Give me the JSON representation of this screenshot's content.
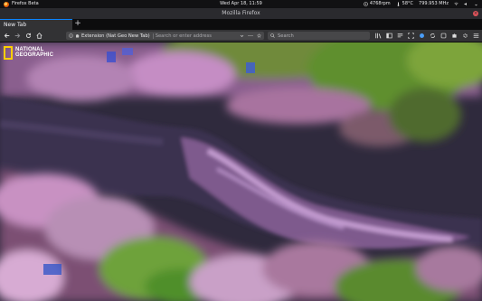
{
  "system_bar": {
    "app_name": "Firefox Beta",
    "clock": "Wed Apr 18, 11:59",
    "cpu_fan": "4768rpm",
    "temperature": "58°C",
    "cpu_freq": "799.953 MHz"
  },
  "window": {
    "title": "Mozilla Firefox"
  },
  "tabs": [
    {
      "label": "New Tab",
      "active": true
    }
  ],
  "new_tab_symbol": "+",
  "url_bar": {
    "identity_label": "Extension (Nat Geo New Tab)",
    "placeholder": "Search or enter address",
    "value": ""
  },
  "search_bar": {
    "placeholder": "Search",
    "value": ""
  },
  "logo": {
    "line1": "NATIONAL",
    "line2": "GEOGRAPHIC"
  },
  "icons": {
    "nav": [
      "back-icon",
      "forward-icon",
      "reload-icon",
      "home-icon"
    ],
    "url_right": [
      "dropdown-icon",
      "page-actions-icon",
      "bookmark-star-icon"
    ],
    "toolbar": [
      "library-icon",
      "sidebar-icon",
      "reader-icon",
      "screenshot-icon",
      "extension-icon",
      "sync-icon",
      "addons-icon",
      "puzzle-icon",
      "gear-icon",
      "menu-icon"
    ]
  },
  "colors": {
    "accent": "#0a84ff",
    "natgeo_yellow": "#ffcf00",
    "close_button": "#e0535a"
  }
}
